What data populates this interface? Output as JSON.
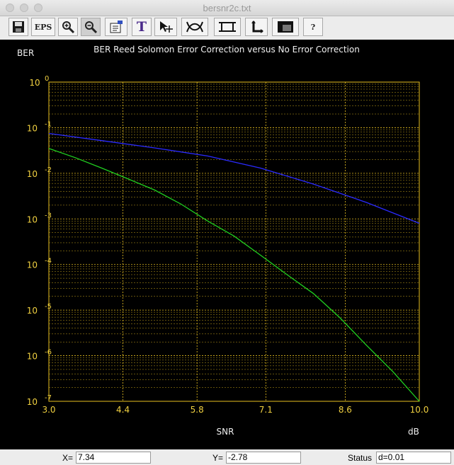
{
  "window": {
    "title": "bersnr2c.txt"
  },
  "toolbar": {
    "buttons": [
      {
        "name": "save-icon",
        "label": ""
      },
      {
        "name": "eps-button",
        "label": "EPS"
      },
      {
        "name": "zoom-in-icon",
        "label": ""
      },
      {
        "name": "zoom-out-icon",
        "label": ""
      },
      {
        "name": "properties-icon",
        "label": ""
      },
      {
        "name": "text-icon",
        "label": "T"
      },
      {
        "name": "pointer-move-icon",
        "label": ""
      },
      {
        "name": "curve-fit-icon",
        "label": ""
      },
      {
        "name": "frame-icon",
        "label": ""
      },
      {
        "name": "axes-icon",
        "label": ""
      },
      {
        "name": "colors-icon",
        "label": ""
      },
      {
        "name": "help-icon",
        "label": "?"
      }
    ]
  },
  "colors": {
    "background": "#000000",
    "grid": "#e8c020",
    "text": "#f0f0f0",
    "tick_label": "#f0d040",
    "series1": "#2a2aff",
    "series2": "#20d020"
  },
  "chart_data": {
    "type": "line",
    "title": "BER Reed Solomon Error Correction versus No Error Correction",
    "ylabel": "BER",
    "xlabel": "SNR",
    "xunit": "dB",
    "xlim": [
      3.0,
      10.0
    ],
    "ylim": [
      1e-07,
      1
    ],
    "yscale": "log",
    "grid": true,
    "x_ticks": [
      "3.0",
      "4.4",
      "5.8",
      "7.1",
      "8.6",
      "10.0"
    ],
    "y_ticks": [
      {
        "base": "10",
        "exp": "0"
      },
      {
        "base": "10",
        "exp": "-1"
      },
      {
        "base": "10",
        "exp": "-2"
      },
      {
        "base": "10",
        "exp": "-3"
      },
      {
        "base": "10",
        "exp": "-4"
      },
      {
        "base": "10",
        "exp": "-5"
      },
      {
        "base": "10",
        "exp": "-6"
      },
      {
        "base": "10",
        "exp": "-7"
      }
    ],
    "series": [
      {
        "x": [
          3.0,
          4.0,
          5.0,
          6.0,
          7.0,
          8.0,
          9.0,
          10.0
        ],
        "values": [
          0.075,
          0.052,
          0.036,
          0.024,
          0.013,
          0.0058,
          0.0023,
          0.0008
        ]
      },
      {
        "x": [
          3.0,
          3.5,
          4.0,
          4.5,
          5.0,
          5.5,
          6.0,
          6.5,
          7.0,
          7.5,
          8.0,
          8.5,
          9.0,
          9.5,
          10.0
        ],
        "values": [
          0.035,
          0.022,
          0.013,
          0.0075,
          0.0043,
          0.0021,
          0.0009,
          0.00042,
          0.00016,
          6e-05,
          2.3e-05,
          6.8e-06,
          1.7e-06,
          4.5e-07,
          1e-07
        ]
      }
    ]
  },
  "status": {
    "x_label": "X=",
    "x_value": "7.34",
    "y_label": "Y=",
    "y_value": "-2.78",
    "status_label": "Status",
    "status_value": "d=0.01"
  }
}
